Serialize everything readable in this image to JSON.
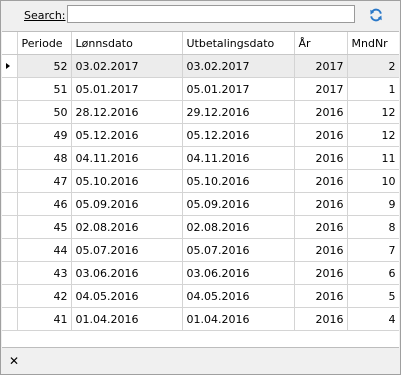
{
  "search": {
    "label": "Search:",
    "value": "",
    "placeholder": ""
  },
  "table": {
    "columns": [
      "Periode",
      "Lønnsdato",
      "Utbetalingsdato",
      "År",
      "MndNr"
    ],
    "selected_row_index": 0,
    "rows": [
      [
        "52",
        "03.02.2017",
        "03.02.2017",
        "2017",
        "2"
      ],
      [
        "51",
        "05.01.2017",
        "05.01.2017",
        "2017",
        "1"
      ],
      [
        "50",
        "28.12.2016",
        "29.12.2016",
        "2016",
        "12"
      ],
      [
        "49",
        "05.12.2016",
        "05.12.2016",
        "2016",
        "12"
      ],
      [
        "48",
        "04.11.2016",
        "04.11.2016",
        "2016",
        "11"
      ],
      [
        "47",
        "05.10.2016",
        "05.10.2016",
        "2016",
        "10"
      ],
      [
        "46",
        "05.09.2016",
        "05.09.2016",
        "2016",
        "9"
      ],
      [
        "45",
        "02.08.2016",
        "02.08.2016",
        "2016",
        "8"
      ],
      [
        "44",
        "05.07.2016",
        "05.07.2016",
        "2016",
        "7"
      ],
      [
        "43",
        "03.06.2016",
        "03.06.2016",
        "2016",
        "6"
      ],
      [
        "42",
        "04.05.2016",
        "04.05.2016",
        "2016",
        "5"
      ],
      [
        "41",
        "01.04.2016",
        "01.04.2016",
        "2016",
        "4"
      ]
    ]
  },
  "icons": {
    "refresh": "refresh-icon",
    "close": "close-icon",
    "row_indicator": "row-pointer-icon"
  },
  "colors": {
    "refresh_icon": "#2a78c8",
    "selected_row": "#ececec"
  }
}
